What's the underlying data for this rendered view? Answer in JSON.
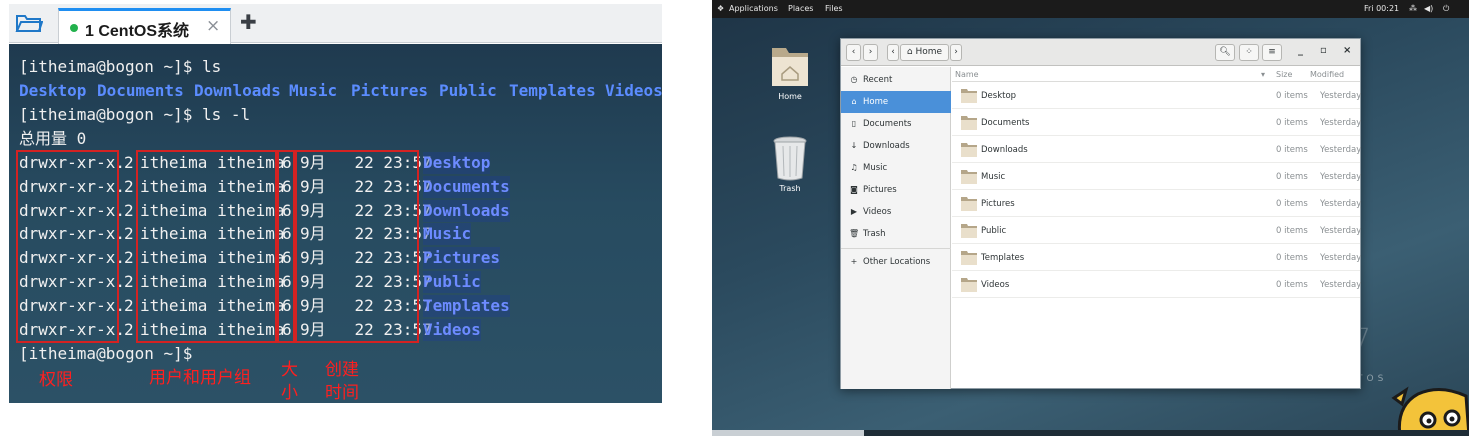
{
  "terminal": {
    "tab_label": "1 CentOS系统",
    "tab_close": "×",
    "new_tab": "✚",
    "prompt1": "[itheima@bogon ~]$ ls",
    "ls_dirs": [
      "Desktop",
      "Documents",
      "Downloads",
      "Music",
      "Pictures",
      "Public",
      "Templates",
      "Videos"
    ],
    "prompt2": "[itheima@bogon ~]$ ls -l",
    "total_line": "总用量 0",
    "rows": [
      {
        "perm": "drwxr-xr-x.",
        "links": "2",
        "owner": "itheima itheima",
        "size": "6",
        "date": "9月   22 23:57",
        "name": "Desktop"
      },
      {
        "perm": "drwxr-xr-x.",
        "links": "2",
        "owner": "itheima itheima",
        "size": "6",
        "date": "9月   22 23:57",
        "name": "Documents"
      },
      {
        "perm": "drwxr-xr-x.",
        "links": "2",
        "owner": "itheima itheima",
        "size": "6",
        "date": "9月   22 23:57",
        "name": "Downloads"
      },
      {
        "perm": "drwxr-xr-x.",
        "links": "2",
        "owner": "itheima itheima",
        "size": "6",
        "date": "9月   22 23:57",
        "name": "Music"
      },
      {
        "perm": "drwxr-xr-x.",
        "links": "2",
        "owner": "itheima itheima",
        "size": "6",
        "date": "9月   22 23:57",
        "name": "Pictures"
      },
      {
        "perm": "drwxr-xr-x.",
        "links": "2",
        "owner": "itheima itheima",
        "size": "6",
        "date": "9月   22 23:57",
        "name": "Public"
      },
      {
        "perm": "drwxr-xr-x.",
        "links": "2",
        "owner": "itheima itheima",
        "size": "6",
        "date": "9月   22 23:57",
        "name": "Templates"
      },
      {
        "perm": "drwxr-xr-x.",
        "links": "2",
        "owner": "itheima itheima",
        "size": "6",
        "date": "9月   22 23:57",
        "name": "Videos"
      }
    ],
    "prompt3": "[itheima@bogon ~]$",
    "annotations": {
      "perm": "权限",
      "owner": "用户和用户组",
      "size_1": "大",
      "size_2": "小",
      "time_1": "创建",
      "time_2": "时间"
    }
  },
  "desktop": {
    "topbar": {
      "applications": "Applications",
      "places": "Places",
      "files": "Files",
      "clock": "Fri 00:21"
    },
    "icons": {
      "home": "Home",
      "trash": "Trash"
    },
    "watermark": "7",
    "watermark_tag": "TOS"
  },
  "file_manager": {
    "location": "Home",
    "sidebar": [
      {
        "icon": "clock-icon",
        "label": "Recent"
      },
      {
        "icon": "home-icon",
        "label": "Home"
      },
      {
        "icon": "document-icon",
        "label": "Documents"
      },
      {
        "icon": "download-icon",
        "label": "Downloads"
      },
      {
        "icon": "music-icon",
        "label": "Music"
      },
      {
        "icon": "camera-icon",
        "label": "Pictures"
      },
      {
        "icon": "video-icon",
        "label": "Videos"
      },
      {
        "icon": "trash-icon",
        "label": "Trash"
      },
      {
        "icon": "plus-icon",
        "label": "Other Locations"
      }
    ],
    "active_sidebar": "Home",
    "columns": {
      "name": "Name",
      "size": "Size",
      "modified": "Modified"
    },
    "files": [
      {
        "name": "Desktop",
        "size": "0 items",
        "modified": "Yesterday"
      },
      {
        "name": "Documents",
        "size": "0 items",
        "modified": "Yesterday"
      },
      {
        "name": "Downloads",
        "size": "0 items",
        "modified": "Yesterday"
      },
      {
        "name": "Music",
        "size": "0 items",
        "modified": "Yesterday"
      },
      {
        "name": "Pictures",
        "size": "0 items",
        "modified": "Yesterday"
      },
      {
        "name": "Public",
        "size": "0 items",
        "modified": "Yesterday"
      },
      {
        "name": "Templates",
        "size": "0 items",
        "modified": "Yesterday"
      },
      {
        "name": "Videos",
        "size": "0 items",
        "modified": "Yesterday"
      }
    ]
  },
  "colors": {
    "terminal_bg": "#274b60",
    "dir_blue": "#5b8cff",
    "annotation_red": "#ff1f1f",
    "selection_blue": "#4a90d9"
  }
}
